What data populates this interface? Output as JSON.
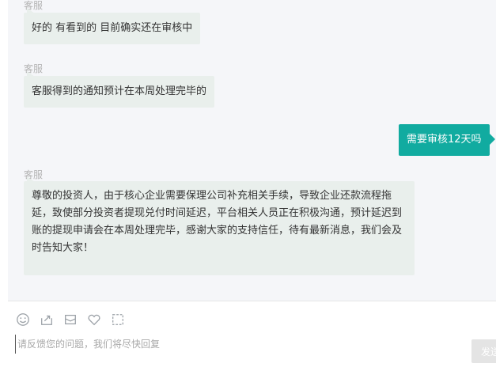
{
  "messages": [
    {
      "sender": "客服",
      "text": "好的 有看到的 目前确实还在审核中"
    },
    {
      "sender": "客服",
      "text": "客服得到的通知预计在本周处理完毕的"
    },
    {
      "text": "需要审核12天吗"
    },
    {
      "sender": "客服",
      "text": "尊敬的投资人，由于核心企业需要保理公司补充相关手续，导致企业还款流程拖延，致使部分投资者提现兑付时间延迟，平台相关人员正在积极沟通，预计延迟到账的提现申请会在本周处理完毕，感谢大家的支持信任，待有最新消息，我们会及时告知大家！"
    }
  ],
  "composer": {
    "placeholder": "请反馈您的问题，我们将尽快回复",
    "send_label": "发送",
    "tools": [
      "emoji-icon",
      "upload-icon",
      "mail-icon",
      "heart-icon",
      "screenshot-icon"
    ]
  },
  "colors": {
    "agent_bubble": "#e9efec",
    "user_bubble": "#11aba0",
    "chat_bg": "#f5f6f9"
  }
}
